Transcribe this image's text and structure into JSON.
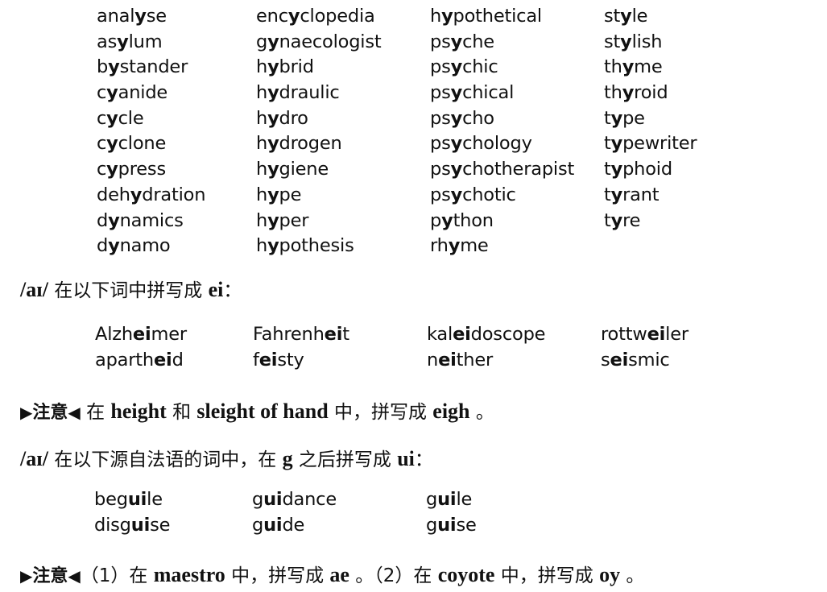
{
  "y_words": [
    {
      "pre": "anal",
      "bold": "y",
      "post": "se"
    },
    {
      "pre": "as",
      "bold": "y",
      "post": "lum"
    },
    {
      "pre": "b",
      "bold": "y",
      "post": "stander"
    },
    {
      "pre": "c",
      "bold": "y",
      "post": "anide"
    },
    {
      "pre": "c",
      "bold": "y",
      "post": "cle"
    },
    {
      "pre": "c",
      "bold": "y",
      "post": "clone"
    },
    {
      "pre": "c",
      "bold": "y",
      "post": "press"
    },
    {
      "pre": "deh",
      "bold": "y",
      "post": "dration"
    },
    {
      "pre": "d",
      "bold": "y",
      "post": "namics"
    },
    {
      "pre": "d",
      "bold": "y",
      "post": "namo"
    },
    {
      "pre": "enc",
      "bold": "y",
      "post": "clopedia"
    },
    {
      "pre": "g",
      "bold": "y",
      "post": "naecologist"
    },
    {
      "pre": "h",
      "bold": "y",
      "post": "brid"
    },
    {
      "pre": "h",
      "bold": "y",
      "post": "draulic"
    },
    {
      "pre": "h",
      "bold": "y",
      "post": "dro"
    },
    {
      "pre": "h",
      "bold": "y",
      "post": "drogen"
    },
    {
      "pre": "h",
      "bold": "y",
      "post": "giene"
    },
    {
      "pre": "h",
      "bold": "y",
      "post": "pe"
    },
    {
      "pre": "h",
      "bold": "y",
      "post": "per"
    },
    {
      "pre": "h",
      "bold": "y",
      "post": "pothesis"
    },
    {
      "pre": "h",
      "bold": "y",
      "post": "pothetical"
    },
    {
      "pre": "ps",
      "bold": "y",
      "post": "che"
    },
    {
      "pre": "ps",
      "bold": "y",
      "post": "chic"
    },
    {
      "pre": "ps",
      "bold": "y",
      "post": "chical"
    },
    {
      "pre": "ps",
      "bold": "y",
      "post": "cho"
    },
    {
      "pre": "ps",
      "bold": "y",
      "post": "chology"
    },
    {
      "pre": "ps",
      "bold": "y",
      "post": "chotherapist"
    },
    {
      "pre": "ps",
      "bold": "y",
      "post": "chotic"
    },
    {
      "pre": "p",
      "bold": "y",
      "post": "thon"
    },
    {
      "pre": "rh",
      "bold": "y",
      "post": "me"
    },
    {
      "pre": "st",
      "bold": "y",
      "post": "le"
    },
    {
      "pre": "st",
      "bold": "y",
      "post": "lish"
    },
    {
      "pre": "th",
      "bold": "y",
      "post": "me"
    },
    {
      "pre": "th",
      "bold": "y",
      "post": "roid"
    },
    {
      "pre": "t",
      "bold": "y",
      "post": "pe"
    },
    {
      "pre": "t",
      "bold": "y",
      "post": "pewriter"
    },
    {
      "pre": "t",
      "bold": "y",
      "post": "phoid"
    },
    {
      "pre": "t",
      "bold": "y",
      "post": "rant"
    },
    {
      "pre": "t",
      "bold": "y",
      "post": "re"
    }
  ],
  "section_ei": {
    "phon": "/aɪ/",
    "text": " 在以下词中拼写成 ",
    "spelling": "ei",
    "end": "："
  },
  "ei_words": [
    {
      "pre": "Alzh",
      "bold": "ei",
      "post": "mer"
    },
    {
      "pre": "aparth",
      "bold": "ei",
      "post": "d"
    },
    {
      "pre": "Fahrenh",
      "bold": "ei",
      "post": "t"
    },
    {
      "pre": "f",
      "bold": "ei",
      "post": "sty"
    },
    {
      "pre": "kal",
      "bold": "ei",
      "post": "doscope"
    },
    {
      "pre": "n",
      "bold": "ei",
      "post": "ther"
    },
    {
      "pre": "rottw",
      "bold": "ei",
      "post": "ler"
    },
    {
      "pre": "s",
      "bold": "ei",
      "post": "smic"
    }
  ],
  "note1": {
    "tri_left": "▶",
    "label": "注意",
    "tri_right": "◀",
    "t1": " 在 ",
    "w1": "height",
    "t2": " 和 ",
    "w2": "sleight of hand",
    "t3": " 中，拼写成 ",
    "w3": "eigh",
    "t4": " 。"
  },
  "section_ui": {
    "phon": "/aɪ/",
    "t1": " 在以下源自法语的词中，在 ",
    "g": "g",
    "t2": " 之后拼写成 ",
    "spelling": "ui",
    "end": "："
  },
  "ui_words": [
    {
      "pre": "beg",
      "bold": "ui",
      "post": "le"
    },
    {
      "pre": "disg",
      "bold": "ui",
      "post": "se"
    },
    {
      "pre": "g",
      "bold": "ui",
      "post": "dance"
    },
    {
      "pre": "g",
      "bold": "ui",
      "post": "de"
    },
    {
      "pre": "g",
      "bold": "ui",
      "post": "le"
    },
    {
      "pre": "g",
      "bold": "ui",
      "post": "se"
    }
  ],
  "note2": {
    "tri_left": "▶",
    "label": "注意",
    "tri_right": "◀",
    "t1": "（1）在 ",
    "w1": "maestro",
    "t2": " 中，拼写成 ",
    "w2": "ae",
    "t3": " 。（2）在 ",
    "w3": "coyote",
    "t4": " 中，拼写成 ",
    "w4": "oy",
    "t5": " 。"
  }
}
